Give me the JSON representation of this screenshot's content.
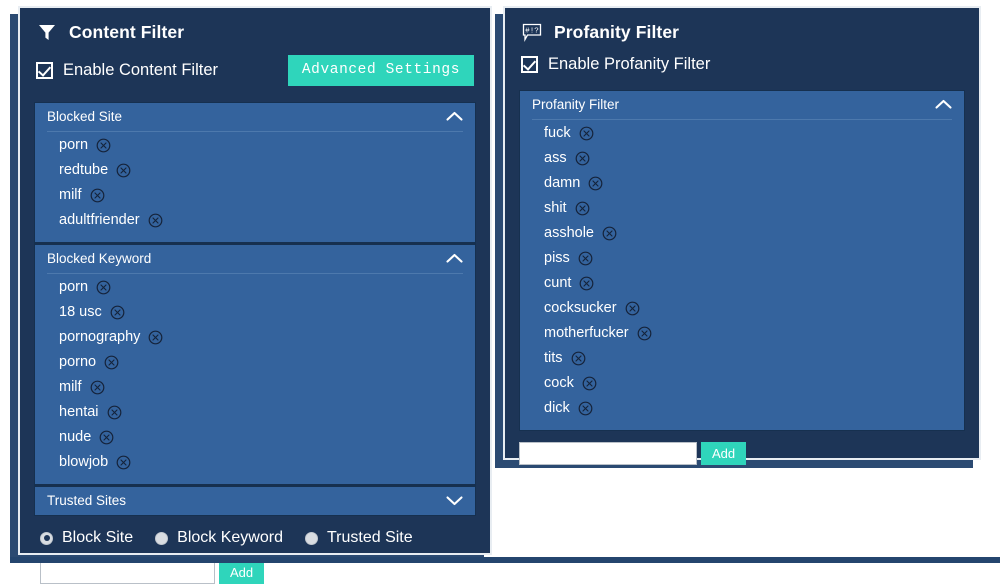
{
  "theme": {
    "panel_bg": "#1d3557",
    "section_bg": "#34639d",
    "accent": "#2fd5bb",
    "border": "#e8edf2",
    "text": "#ffffff"
  },
  "content_filter": {
    "icon": "funnel-icon",
    "title": "Content Filter",
    "enable_label": "Enable Content Filter",
    "enable_checked": true,
    "advanced_button": "Advanced Settings",
    "sections": [
      {
        "id": "blocked-site",
        "title": "Blocked Site",
        "expanded": true,
        "chevron": "chevron-up-icon",
        "items": [
          "porn",
          "redtube",
          "milf",
          "adultfriender"
        ]
      },
      {
        "id": "blocked-keyword",
        "title": "Blocked Keyword",
        "expanded": true,
        "chevron": "chevron-up-icon",
        "items": [
          "porn",
          "18 usc",
          "pornography",
          "porno",
          "milf",
          "hentai",
          "nude",
          "blowjob"
        ]
      },
      {
        "id": "trusted-sites",
        "title": "Trusted Sites",
        "expanded": false,
        "chevron": "chevron-down-icon",
        "items": []
      }
    ],
    "radios": [
      {
        "label": "Block Site",
        "checked": true
      },
      {
        "label": "Block Keyword",
        "checked": false
      },
      {
        "label": "Trusted Site",
        "checked": false
      }
    ],
    "add_input_value": "",
    "add_input_placeholder": "",
    "add_button": "Add"
  },
  "profanity_filter": {
    "icon": "speech-bubble-profanity-icon",
    "icon_glyph": "#!?",
    "title": "Profanity Filter",
    "enable_label": "Enable Profanity Filter",
    "enable_checked": true,
    "sections": [
      {
        "id": "profanity-list",
        "title": "Profanity Filter",
        "expanded": true,
        "chevron": "chevron-up-icon",
        "items": [
          "fuck",
          "ass",
          "damn",
          "shit",
          "asshole",
          "piss",
          "cunt",
          "cocksucker",
          "motherfucker",
          "tits",
          "cock",
          "dick"
        ]
      }
    ],
    "add_input_value": "",
    "add_input_placeholder": "",
    "add_button": "Add"
  }
}
